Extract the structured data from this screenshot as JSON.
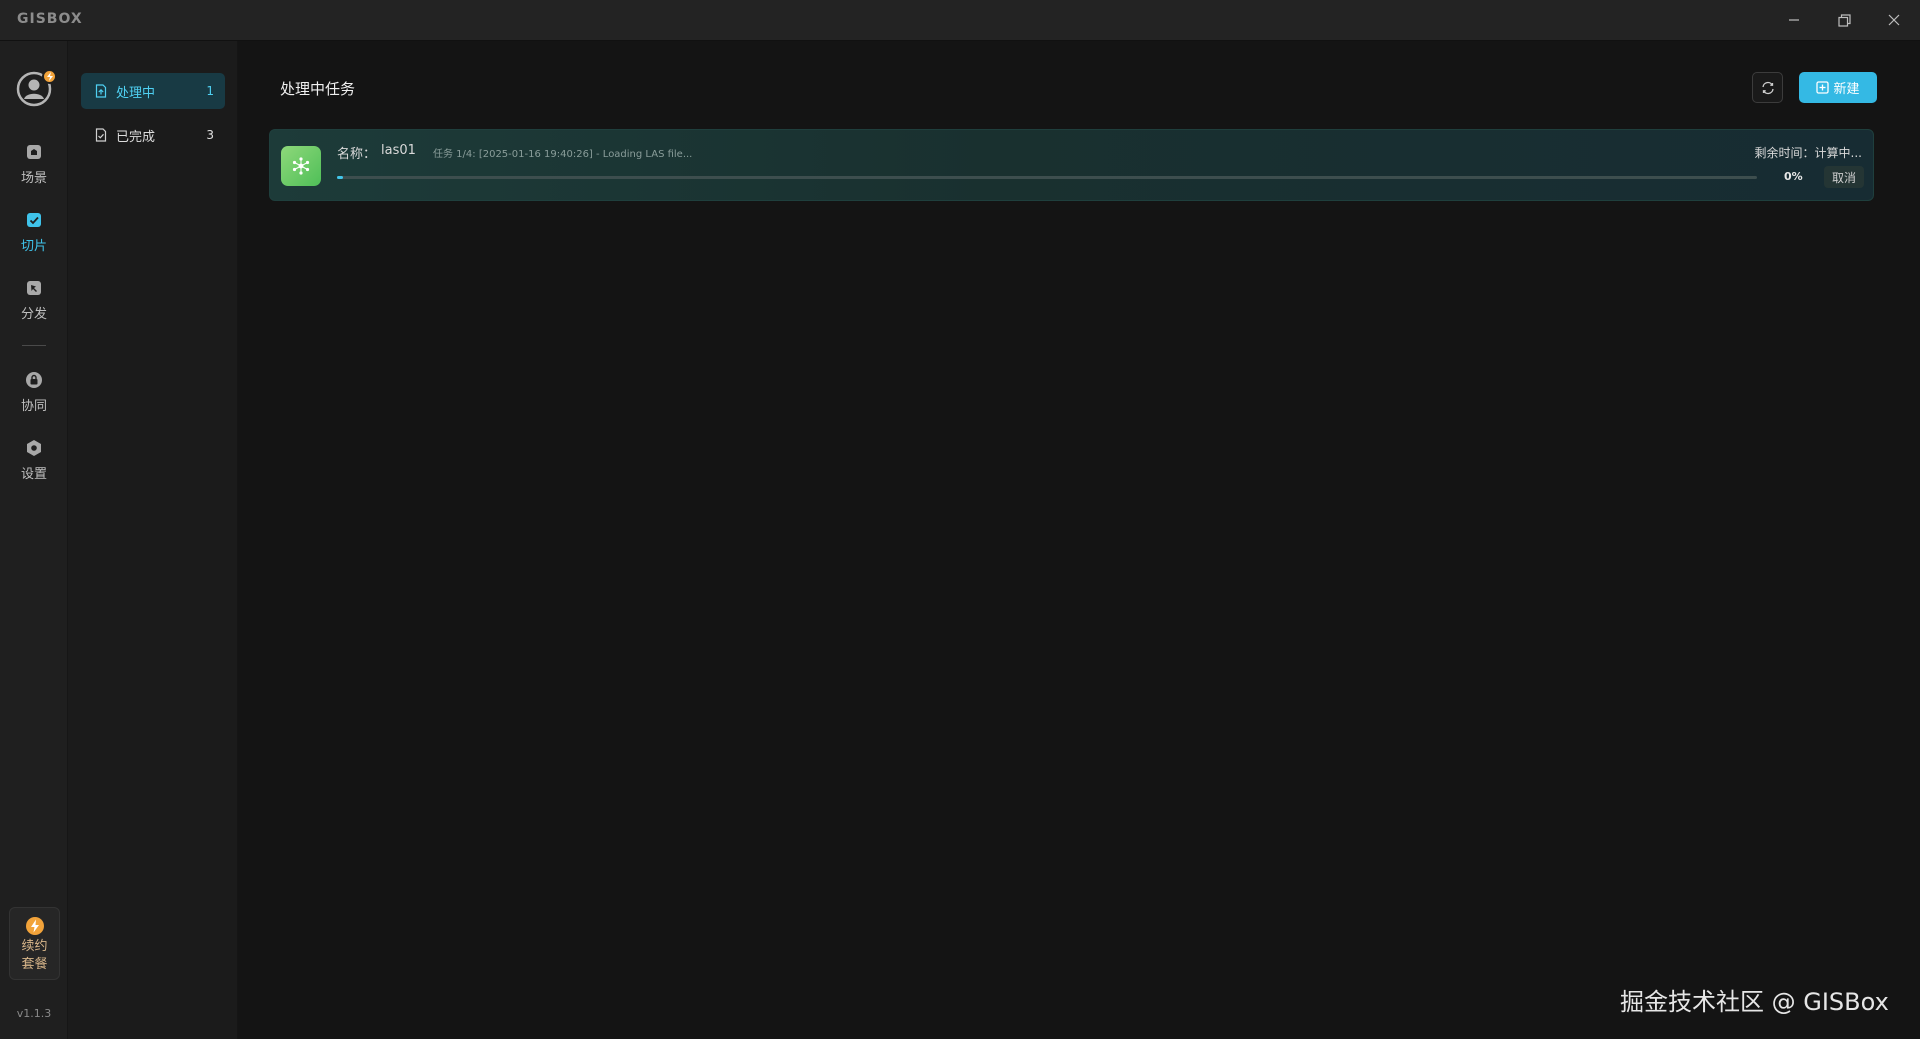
{
  "app": {
    "brand": "GISBOX"
  },
  "titlebar": {
    "controls": [
      {
        "name": "minimize",
        "icon": "minimize-icon"
      },
      {
        "name": "restore",
        "icon": "restore-icon"
      },
      {
        "name": "close",
        "icon": "close-icon"
      }
    ]
  },
  "rail": {
    "items": [
      {
        "label": "场景",
        "icon": "scene-icon",
        "active": false
      },
      {
        "label": "切片",
        "icon": "slice-icon",
        "active": true
      },
      {
        "label": "分发",
        "icon": "distribute-icon",
        "active": false
      },
      {
        "label": "协同",
        "icon": "collaborate-icon",
        "active": false
      },
      {
        "label": "设置",
        "icon": "settings-icon",
        "active": false
      }
    ],
    "renew_label": "续约套餐",
    "version": "v1.1.3"
  },
  "categories": [
    {
      "label": "处理中",
      "count": "1",
      "active": true
    },
    {
      "label": "已完成",
      "count": "3",
      "active": false
    }
  ],
  "main": {
    "title": "处理中任务",
    "new_button": "新建",
    "tasks": [
      {
        "name_label": "名称：",
        "name": "las01",
        "status": "任务 1/4:  [2025-01-16 19:40:26]  -  Loading LAS file...",
        "remaining": "剩余时间：计算中...",
        "progress": 0.004,
        "progress_text": "0%",
        "cancel": "取消"
      }
    ]
  },
  "watermark": "掘金技术社区 @ GISBox",
  "colors": {
    "accent": "#34b9e4",
    "active_text": "#4fd0f2",
    "badge": "#f2a33a"
  }
}
